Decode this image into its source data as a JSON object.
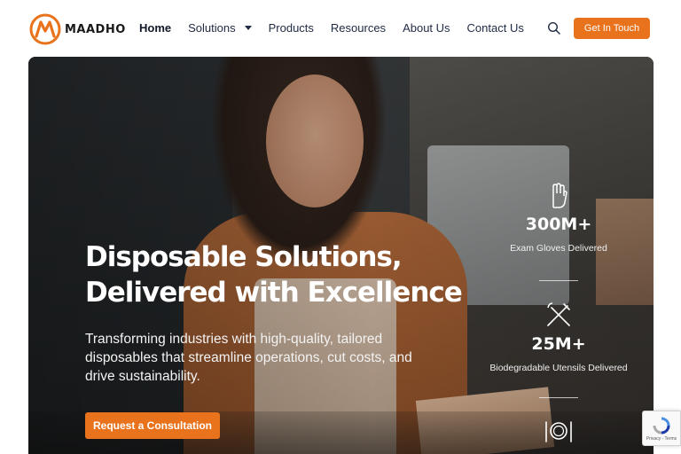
{
  "brand": {
    "name": "MAADHO",
    "accent": "#e8731c"
  },
  "nav": {
    "items": [
      {
        "label": "Home",
        "active": true
      },
      {
        "label": "Solutions",
        "has_dropdown": true
      },
      {
        "label": "Products"
      },
      {
        "label": "Resources"
      },
      {
        "label": "About Us"
      },
      {
        "label": "Contact Us"
      }
    ],
    "search_icon": "search-icon",
    "cta_label": "Get In Touch"
  },
  "hero": {
    "title_line1": "Disposable Solutions,",
    "title_line2": "Delivered with Excellence",
    "subtitle": "Transforming industries with high-quality, tailored disposables that streamline operations, cut costs, and drive sustainability.",
    "cta_label": "Request a Consultation"
  },
  "stats": [
    {
      "icon": "glove-icon",
      "value": "300M+",
      "label": "Exam Gloves Delivered"
    },
    {
      "icon": "utensils-icon",
      "value": "25M+",
      "label": "Biodegradable Utensils Delivered"
    },
    {
      "icon": "plate-icon"
    }
  ],
  "recaptcha": {
    "text": "Privacy - Terms"
  }
}
